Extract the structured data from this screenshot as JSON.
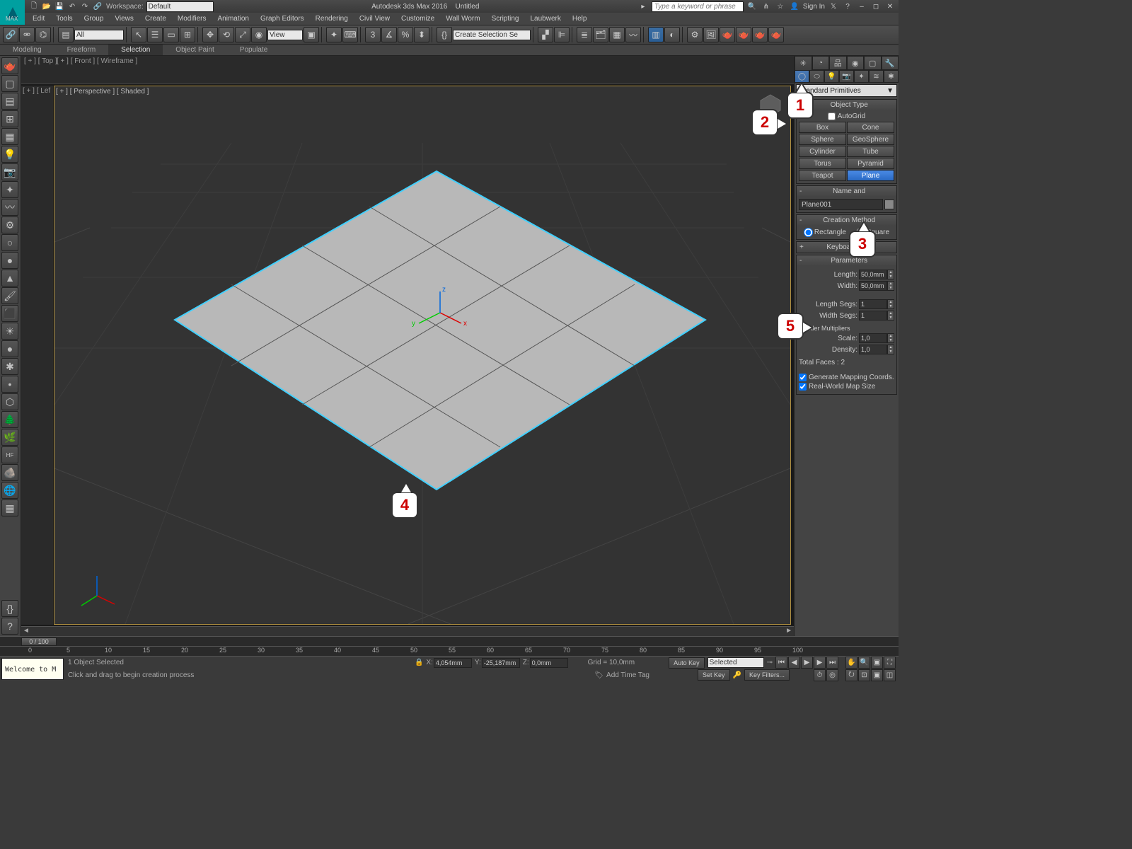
{
  "app": {
    "title": "Autodesk 3ds Max 2016",
    "doc": "Untitled"
  },
  "workspace": {
    "label": "Workspace:",
    "value": "Default"
  },
  "search_placeholder": "Type a keyword or phrase",
  "signin": "Sign In",
  "max_label": "MAX",
  "menus": [
    "Edit",
    "Tools",
    "Group",
    "Views",
    "Create",
    "Modifiers",
    "Animation",
    "Graph Editors",
    "Rendering",
    "Civil View",
    "Customize",
    "Wall Worm",
    "Scripting",
    "Laubwerk",
    "Help"
  ],
  "toolbar_dd": {
    "all": "All",
    "view": "View",
    "selset": "Create Selection Se"
  },
  "ribbon": [
    "Modeling",
    "Freeform",
    "Selection",
    "Object Paint",
    "Populate"
  ],
  "ribbon_active": 2,
  "viewports": {
    "top": "[ + ] [ Top ]",
    "front": "[ + ] [ Front ] [ Wireframe ]",
    "left": "[ + ] [ Lef",
    "persp": "[ + ] [ Perspective ] [ Shaded ]"
  },
  "cmdpanel": {
    "category": "Standard Primitives",
    "ro_object_type": "Object Type",
    "autogrid": "AutoGrid",
    "prims": [
      [
        "Box",
        "Cone"
      ],
      [
        "Sphere",
        "GeoSphere"
      ],
      [
        "Cylinder",
        "Tube"
      ],
      [
        "Torus",
        "Pyramid"
      ],
      [
        "Teapot",
        "Plane"
      ]
    ],
    "active_prim": "Plane",
    "ro_name": "Name and",
    "name_value": "Plane001",
    "ro_creation": "Creation Method",
    "cm_rect": "Rectangle",
    "cm_square": "Square",
    "ro_kbentry": "KeyboardEntry",
    "ro_params": "Parameters",
    "length_lbl": "Length:",
    "length_val": "50,0mm",
    "width_lbl": "Width:",
    "width_val": "50,0mm",
    "lseg_lbl": "Length Segs:",
    "lseg_val": "1",
    "wseg_lbl": "Width Segs:",
    "wseg_val": "1",
    "render_mult": "Render Multipliers",
    "scale_lbl": "Scale:",
    "scale_val": "1,0",
    "density_lbl": "Density:",
    "density_val": "1,0",
    "total_faces": "Total Faces : 2",
    "gen_map": "Generate Mapping Coords.",
    "rw_map": "Real-World Map Size"
  },
  "timeline": {
    "frame": "0 / 100",
    "ticks": [
      0,
      5,
      10,
      15,
      20,
      25,
      30,
      35,
      40,
      45,
      50,
      55,
      60,
      65,
      70,
      75,
      80,
      85,
      90,
      95,
      100
    ]
  },
  "status": {
    "welcome": "Welcome to M",
    "sel": "1 Object Selected",
    "hint": "Click and drag to begin creation process",
    "x_lbl": "X:",
    "x": "4,054mm",
    "y_lbl": "Y:",
    "y": "-25,187mm",
    "z_lbl": "Z:",
    "z": "0,0mm",
    "grid": "Grid = 10,0mm",
    "addtag": "Add Time Tag",
    "autokey": "Auto Key",
    "setkey": "Set Key",
    "selected": "Selected",
    "keyfilters": "Key Filters..."
  },
  "callouts": {
    "1": "1",
    "2": "2",
    "3": "3",
    "4": "4",
    "5": "5"
  }
}
